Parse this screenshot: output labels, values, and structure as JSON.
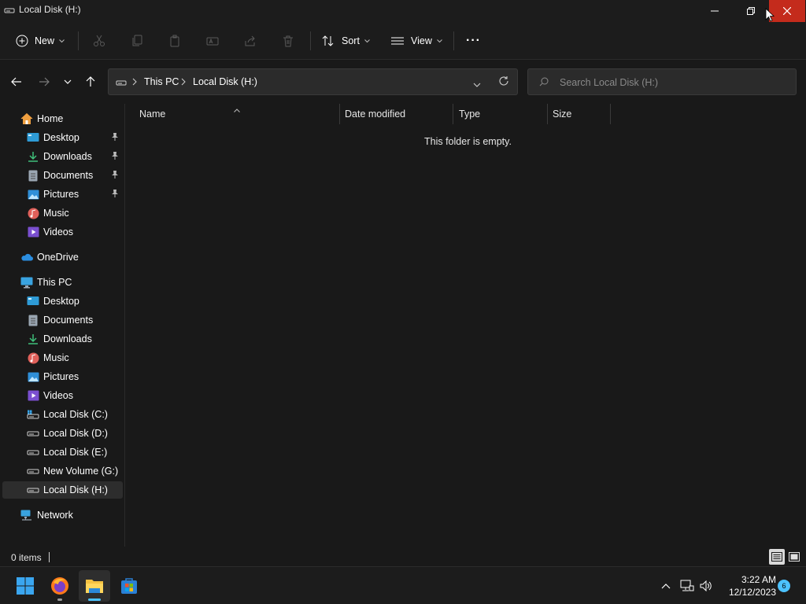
{
  "window": {
    "title": "Local Disk (H:)"
  },
  "commandbar": {
    "new_label": "New",
    "sort_label": "Sort",
    "view_label": "View",
    "more_label": "···"
  },
  "navbar": {
    "breadcrumbs": [
      "This PC",
      "Local Disk (H:)"
    ],
    "search_placeholder": "Search Local Disk (H:)"
  },
  "sidebar": {
    "quick": [
      {
        "label": "Home",
        "icon": "home-icon"
      },
      {
        "label": "Desktop",
        "icon": "desktop-icon",
        "pinned": true
      },
      {
        "label": "Downloads",
        "icon": "downloads-icon",
        "pinned": true
      },
      {
        "label": "Documents",
        "icon": "documents-icon",
        "pinned": true
      },
      {
        "label": "Pictures",
        "icon": "pictures-icon",
        "pinned": true
      },
      {
        "label": "Music",
        "icon": "music-icon"
      },
      {
        "label": "Videos",
        "icon": "videos-icon"
      }
    ],
    "onedrive": {
      "label": "OneDrive",
      "icon": "onedrive-icon"
    },
    "thispc": {
      "label": "This PC",
      "icon": "pc-icon"
    },
    "pc_items": [
      {
        "label": "Desktop",
        "icon": "desktop-icon"
      },
      {
        "label": "Documents",
        "icon": "documents-icon"
      },
      {
        "label": "Downloads",
        "icon": "downloads-icon"
      },
      {
        "label": "Music",
        "icon": "music-icon"
      },
      {
        "label": "Pictures",
        "icon": "pictures-icon"
      },
      {
        "label": "Videos",
        "icon": "videos-icon"
      },
      {
        "label": "Local Disk (C:)",
        "icon": "system-drive-icon"
      },
      {
        "label": "Local Disk (D:)",
        "icon": "drive-icon"
      },
      {
        "label": "Local Disk (E:)",
        "icon": "drive-icon"
      },
      {
        "label": "New Volume (G:)",
        "icon": "drive-icon"
      },
      {
        "label": "Local Disk (H:)",
        "icon": "drive-icon",
        "selected": true
      }
    ],
    "network": {
      "label": "Network",
      "icon": "network-icon"
    }
  },
  "columns": {
    "name": "Name",
    "date": "Date modified",
    "type": "Type",
    "size": "Size"
  },
  "content": {
    "empty_message": "This folder is empty."
  },
  "status": {
    "item_count": "0 items"
  },
  "taskbar": {
    "time": "3:22 AM",
    "date": "12/12/2023",
    "notifications": "6"
  },
  "colors": {
    "accent": "#4cc2ff",
    "close_hover": "#c42b1c",
    "background": "#191919"
  }
}
